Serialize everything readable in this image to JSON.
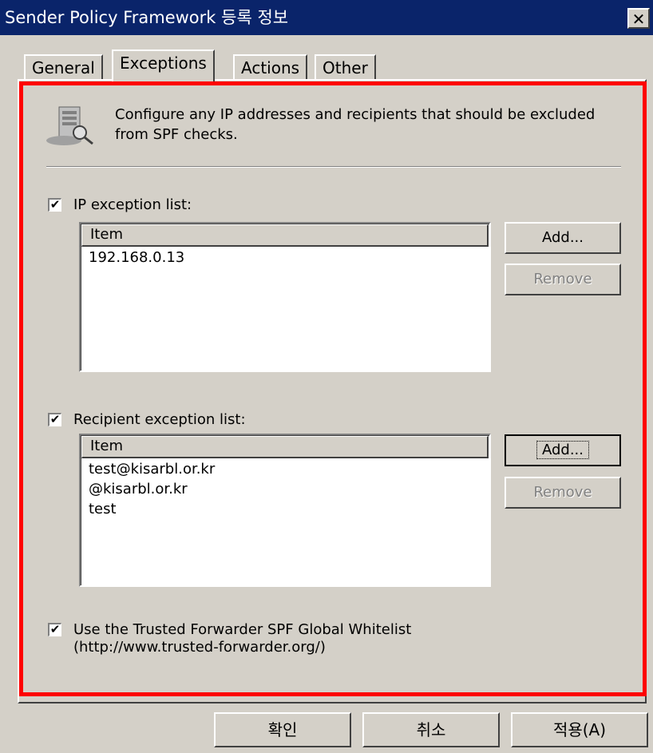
{
  "window": {
    "title": "Sender Policy Framework 등록 정보",
    "close_label": "✕"
  },
  "tabs": [
    {
      "label": "General",
      "active": false
    },
    {
      "label": "Exceptions",
      "active": true
    },
    {
      "label": "Actions",
      "active": false
    },
    {
      "label": "Other",
      "active": false
    }
  ],
  "intro": {
    "text": "Configure any IP addresses and recipients that should be excluded from SPF checks.",
    "icon": "server-icon"
  },
  "ip_exceptions": {
    "checked": true,
    "check_mark": "✔",
    "label": "IP exception list:",
    "column_header": "Item",
    "items": [
      "192.168.0.13"
    ],
    "add_label": "Add...",
    "remove_label": "Remove"
  },
  "recipient_exceptions": {
    "checked": true,
    "check_mark": "✔",
    "label": "Recipient exception list:",
    "column_header": "Item",
    "items": [
      "test@kisarbl.or.kr",
      "@kisarbl.or.kr",
      "test"
    ],
    "add_label": "Add...",
    "remove_label": "Remove"
  },
  "whitelist": {
    "checked": true,
    "check_mark": "✔",
    "label_line1": "Use the Trusted Forwarder SPF Global Whitelist",
    "label_line2": "(http://www.trusted-forwarder.org/)"
  },
  "footer": {
    "ok_label": "확인",
    "cancel_label": "취소",
    "apply_label": "적용(A)"
  },
  "colors": {
    "title_bar": "#0a246a",
    "face": "#d4d0c8",
    "highlight_border": "#ff0000"
  }
}
